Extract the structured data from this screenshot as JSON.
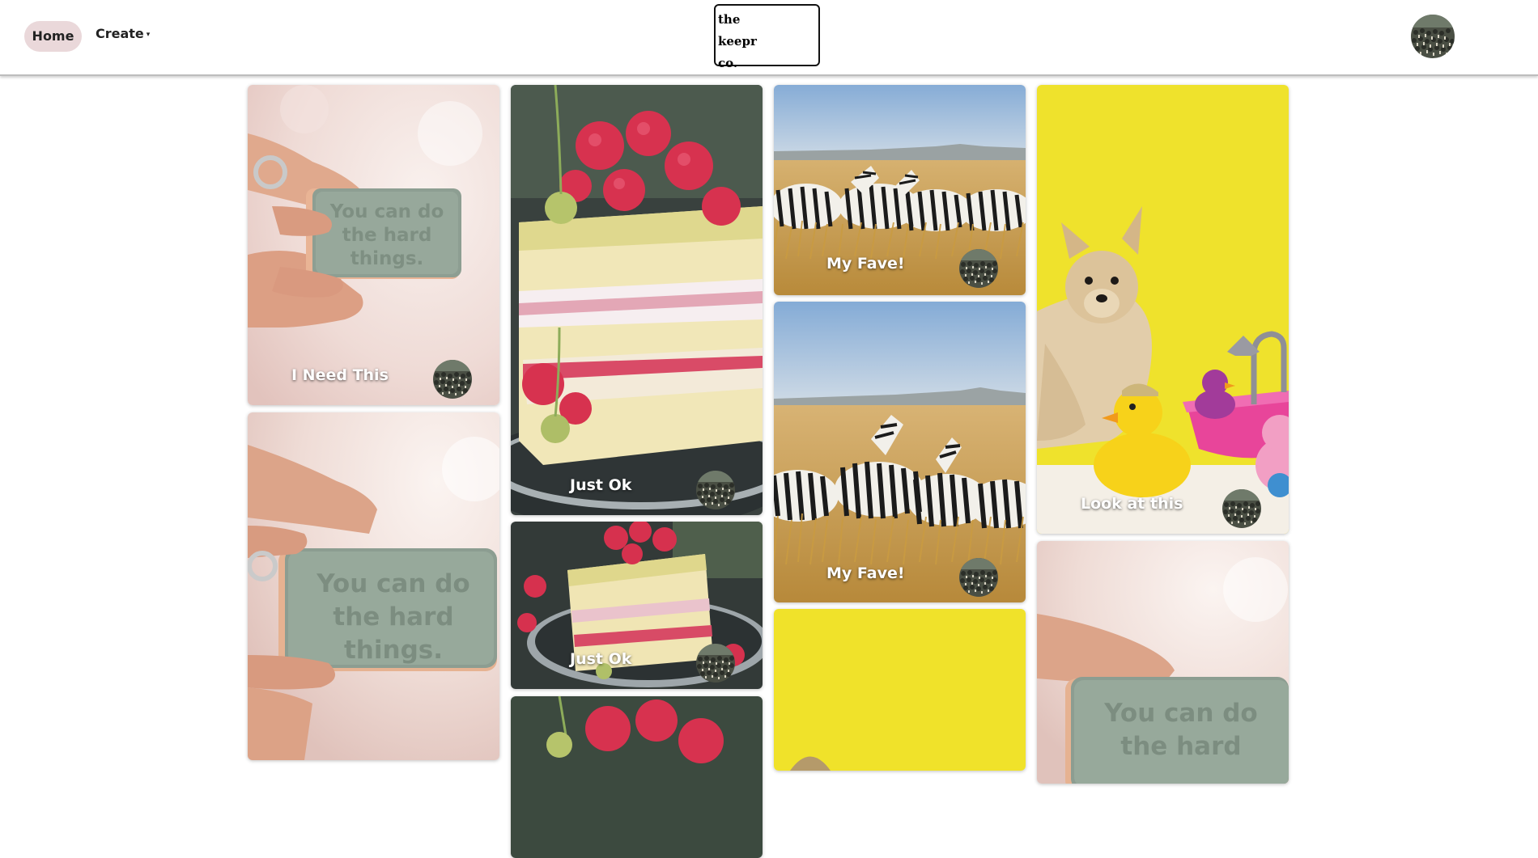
{
  "nav": {
    "home_label": "Home",
    "create_label": "Create",
    "logo_lines": [
      "the",
      "keepr",
      "co."
    ],
    "user_avatar": "crowd-photo-avatar-icon"
  },
  "cards": [
    {
      "title": "I Need This",
      "image": "soap-bar-photo",
      "image_text": [
        "You can do",
        "the hard",
        "things."
      ]
    },
    {
      "title": "",
      "image": "soap-bar-photo",
      "image_text": [
        "You can do",
        "the hard",
        "things."
      ]
    },
    {
      "title": "Just Ok",
      "image": "raspberry-cake-photo"
    },
    {
      "title": "Just Ok",
      "image": "raspberry-cake-photo"
    },
    {
      "title": "",
      "image": "raspberry-cake-photo"
    },
    {
      "title": "My Fave!",
      "image": "zebras-savanna-photo"
    },
    {
      "title": "My Fave!",
      "image": "zebras-savanna-photo"
    },
    {
      "title": "",
      "image": "yellow-background-photo"
    },
    {
      "title": "Look at this",
      "image": "dog-rubber-ducks-photo"
    },
    {
      "title": "",
      "image": "soap-bar-photo",
      "image_text": [
        "You can do",
        "the hard"
      ]
    }
  ],
  "colors": {
    "home_pill": "#ead8da",
    "yellow": "#f0e22a",
    "sky": "#8fb4da",
    "grass": "#c99b42"
  }
}
